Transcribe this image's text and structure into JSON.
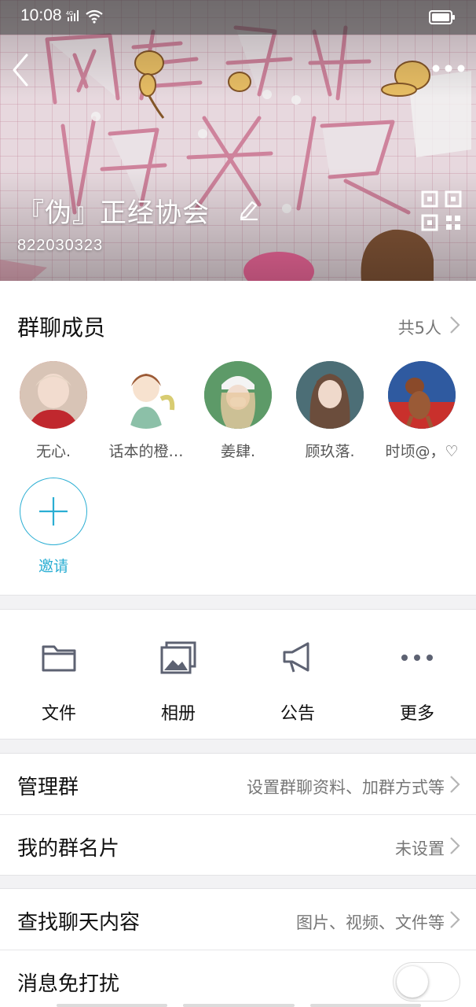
{
  "status_bar": {
    "time": "10:08",
    "network": "4G"
  },
  "header": {
    "group_name": "『伪』正经协会",
    "group_id": "822030323",
    "back_icon": "back-arrow-icon",
    "more_icon": "more-dots-icon",
    "qr_icon": "qr-code-icon",
    "edit_icon": "edit-pencil-icon"
  },
  "members": {
    "title": "群聊成员",
    "count_label": "共5人",
    "list": [
      {
        "name": "无心.",
        "avatar_color": "#c84b4b"
      },
      {
        "name": "话本的橙…",
        "avatar_color": "#e9d6c0"
      },
      {
        "name": "姜肆.",
        "avatar_color": "#4f8a5a"
      },
      {
        "name": "顾玖落.",
        "avatar_color": "#3d5f68"
      },
      {
        "name": "时顷@，♡",
        "avatar_color": "#2b4f8c"
      }
    ],
    "invite_label": "邀请"
  },
  "actions": [
    {
      "label": "文件",
      "icon": "folder-icon"
    },
    {
      "label": "相册",
      "icon": "photo-album-icon"
    },
    {
      "label": "公告",
      "icon": "megaphone-icon"
    },
    {
      "label": "更多",
      "icon": "more-horizontal-icon"
    }
  ],
  "rows": {
    "manage": {
      "title": "管理群",
      "value": "设置群聊资料、加群方式等"
    },
    "my_card": {
      "title": "我的群名片",
      "value": "未设置"
    },
    "search": {
      "title": "查找聊天内容",
      "value": "图片、视频、文件等"
    },
    "mute": {
      "title": "消息免打扰",
      "enabled": false
    }
  },
  "colors": {
    "accent": "#2aaed3",
    "icon_gray": "#5d6272",
    "secondary_text": "#777777",
    "background_gap": "#f2f2f4"
  }
}
